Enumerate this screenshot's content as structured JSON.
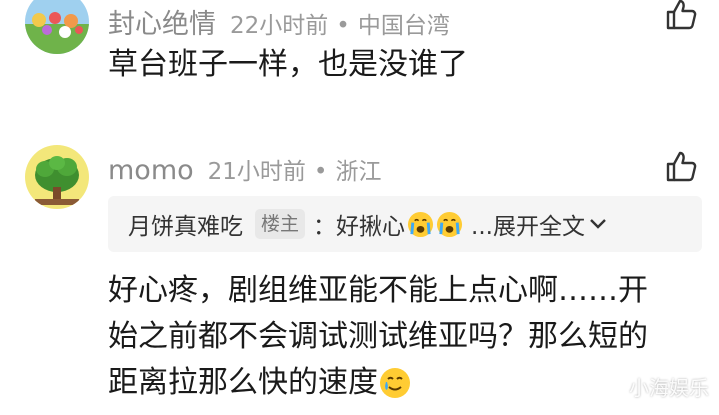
{
  "comments": [
    {
      "username": "封心绝情",
      "time": "22小时前",
      "separator": "•",
      "location": "中国台湾",
      "content": "草台班子一样，也是没谁了",
      "like_icon": "thumbs-up-icon",
      "avatar_icon": "colorful-garden-avatar"
    },
    {
      "username": "momo",
      "time": "21小时前",
      "separator": "•",
      "location": "浙江",
      "like_icon": "thumbs-up-icon",
      "avatar_icon": "green-bush-avatar",
      "quote": {
        "user": "月饼真难吃",
        "badge": "楼主",
        "text": "：好揪心",
        "emoji": "crying-face-emoji",
        "more": "...展开全文"
      },
      "content_lines": [
        "好心疼，剧组维亚能不能上点心啊……开",
        "始之前都不会调试测试维亚吗？那么短的",
        "距离拉那么快的速度"
      ],
      "trailing_emoji": "smiling-with-tear-emoji"
    }
  ],
  "watermark": "小海娱乐"
}
